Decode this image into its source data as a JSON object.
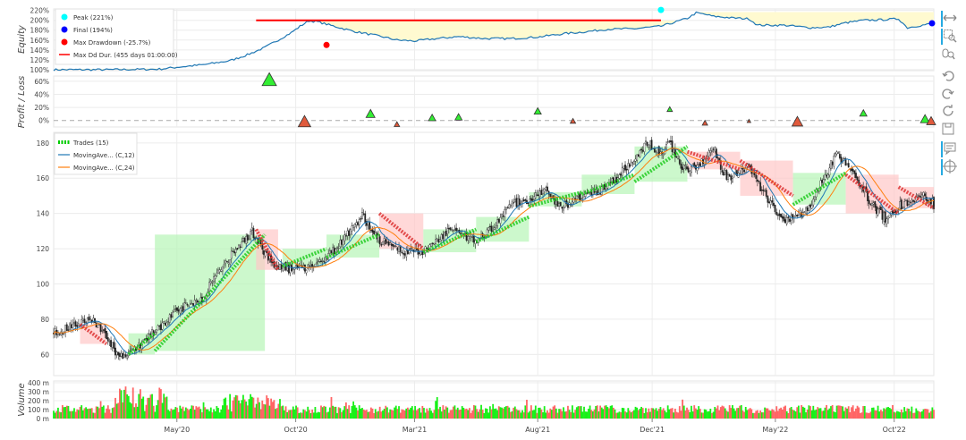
{
  "chart_data": {
    "type": "candlestick-backtest",
    "x_ticks": [
      "May'20",
      "Oct'20",
      "Mar'21",
      "Aug'21",
      "Dec'21",
      "May'22",
      "Oct'22"
    ],
    "equity": {
      "ylabel": "Equity",
      "y_ticks": [
        "220%",
        "200%",
        "180%",
        "160%",
        "140%",
        "120%",
        "100%"
      ],
      "ylim": [
        98,
        223
      ],
      "legend": {
        "peak": "Peak (221%)",
        "final": "Final (194%)",
        "max_drawdown": "Max Drawdown (-25.7%)",
        "max_dd_dur": "Max Dd Dur. (455 days 01:00:00)"
      },
      "points": [
        [
          0,
          100
        ],
        [
          0.06,
          100
        ],
        [
          0.12,
          101
        ],
        [
          0.14,
          105
        ],
        [
          0.17,
          110
        ],
        [
          0.2,
          118
        ],
        [
          0.22,
          130
        ],
        [
          0.24,
          145
        ],
        [
          0.26,
          165
        ],
        [
          0.27,
          175
        ],
        [
          0.28,
          188
        ],
        [
          0.29,
          199
        ],
        [
          0.3,
          197
        ],
        [
          0.31,
          192
        ],
        [
          0.34,
          178
        ],
        [
          0.37,
          168
        ],
        [
          0.39,
          160
        ],
        [
          0.41,
          158
        ],
        [
          0.43,
          162
        ],
        [
          0.46,
          167
        ],
        [
          0.49,
          163
        ],
        [
          0.52,
          163
        ],
        [
          0.55,
          166
        ],
        [
          0.58,
          173
        ],
        [
          0.6,
          176
        ],
        [
          0.63,
          182
        ],
        [
          0.66,
          183
        ],
        [
          0.69,
          188
        ],
        [
          0.7,
          193
        ],
        [
          0.72,
          204
        ],
        [
          0.73,
          215
        ],
        [
          0.74,
          212
        ],
        [
          0.75,
          208
        ],
        [
          0.77,
          205
        ],
        [
          0.79,
          203
        ],
        [
          0.8,
          190
        ],
        [
          0.83,
          190
        ],
        [
          0.86,
          185
        ],
        [
          0.88,
          186
        ],
        [
          0.9,
          195
        ],
        [
          0.92,
          200
        ],
        [
          0.94,
          201
        ],
        [
          0.96,
          203
        ],
        [
          0.97,
          185
        ],
        [
          0.98,
          188
        ],
        [
          1.0,
          194
        ]
      ],
      "peak_point": [
        0.69,
        221
      ],
      "final_point": [
        1.0,
        194
      ],
      "drawdown_point": [
        0.31,
        150
      ],
      "dd_duration": [
        0.23,
        0.69,
        200
      ]
    },
    "profit_loss": {
      "ylabel": "Profit / Loss",
      "y_ticks": [
        "60%",
        "40%",
        "20%",
        "0%"
      ],
      "ylim": [
        -10,
        68
      ],
      "trades": [
        {
          "x": 0.245,
          "pnl": 62,
          "size": 8,
          "win": true
        },
        {
          "x": 0.285,
          "pnl": -2,
          "size": 7,
          "win": false
        },
        {
          "x": 0.36,
          "pnl": 10,
          "size": 5,
          "win": true
        },
        {
          "x": 0.39,
          "pnl": -6,
          "size": 3,
          "win": false
        },
        {
          "x": 0.43,
          "pnl": 4,
          "size": 4,
          "win": true
        },
        {
          "x": 0.46,
          "pnl": 5,
          "size": 4,
          "win": true
        },
        {
          "x": 0.55,
          "pnl": 14,
          "size": 4,
          "win": true
        },
        {
          "x": 0.59,
          "pnl": -1,
          "size": 3,
          "win": false
        },
        {
          "x": 0.7,
          "pnl": 17,
          "size": 3,
          "win": true
        },
        {
          "x": 0.74,
          "pnl": -4,
          "size": 3,
          "win": false
        },
        {
          "x": 0.79,
          "pnl": -1,
          "size": 2,
          "win": false
        },
        {
          "x": 0.845,
          "pnl": -2,
          "size": 6,
          "win": false
        },
        {
          "x": 0.92,
          "pnl": 11,
          "size": 4,
          "win": true
        },
        {
          "x": 0.99,
          "pnl": 2,
          "size": 5,
          "win": true
        },
        {
          "x": 1.0,
          "pnl": -1,
          "size": 5,
          "win": false
        }
      ]
    },
    "ohlc": {
      "y_ticks": [
        "180",
        "160",
        "140",
        "120",
        "100",
        "80",
        "60"
      ],
      "ylim": [
        48,
        186
      ],
      "legend": {
        "trades": "Trades (15)",
        "ma1": "MovingAve... (C,12)",
        "ma2": "MovingAve... (C,24)"
      },
      "price_path": [
        [
          0,
          72
        ],
        [
          0.03,
          78
        ],
        [
          0.045,
          80
        ],
        [
          0.06,
          70
        ],
        [
          0.075,
          58
        ],
        [
          0.09,
          62
        ],
        [
          0.11,
          71
        ],
        [
          0.13,
          80
        ],
        [
          0.15,
          88
        ],
        [
          0.17,
          92
        ],
        [
          0.18,
          102
        ],
        [
          0.2,
          115
        ],
        [
          0.225,
          130
        ],
        [
          0.24,
          118
        ],
        [
          0.25,
          111
        ],
        [
          0.27,
          108
        ],
        [
          0.29,
          110
        ],
        [
          0.31,
          115
        ],
        [
          0.33,
          125
        ],
        [
          0.35,
          139
        ],
        [
          0.37,
          125
        ],
        [
          0.385,
          121
        ],
        [
          0.4,
          118
        ],
        [
          0.42,
          119
        ],
        [
          0.44,
          126
        ],
        [
          0.455,
          133
        ],
        [
          0.47,
          126
        ],
        [
          0.48,
          124
        ],
        [
          0.5,
          132
        ],
        [
          0.52,
          145
        ],
        [
          0.54,
          148
        ],
        [
          0.56,
          153
        ],
        [
          0.575,
          143
        ],
        [
          0.6,
          150
        ],
        [
          0.62,
          153
        ],
        [
          0.64,
          160
        ],
        [
          0.66,
          172
        ],
        [
          0.675,
          180
        ],
        [
          0.69,
          174
        ],
        [
          0.7,
          180
        ],
        [
          0.715,
          165
        ],
        [
          0.73,
          166
        ],
        [
          0.75,
          178
        ],
        [
          0.76,
          163
        ],
        [
          0.77,
          160
        ],
        [
          0.79,
          167
        ],
        [
          0.8,
          157
        ],
        [
          0.815,
          145
        ],
        [
          0.83,
          135
        ],
        [
          0.845,
          138
        ],
        [
          0.86,
          145
        ],
        [
          0.875,
          160
        ],
        [
          0.89,
          174
        ],
        [
          0.9,
          168
        ],
        [
          0.915,
          158
        ],
        [
          0.93,
          145
        ],
        [
          0.945,
          137
        ],
        [
          0.96,
          144
        ],
        [
          0.975,
          148
        ],
        [
          0.99,
          150
        ],
        [
          1.0,
          145
        ]
      ],
      "trade_zones": [
        {
          "x0": 0.03,
          "x1": 0.06,
          "entry": 77,
          "exit": 66,
          "win": false
        },
        {
          "x0": 0.085,
          "x1": 0.115,
          "entry": 60,
          "exit": 72,
          "win": true
        },
        {
          "x0": 0.115,
          "x1": 0.24,
          "entry": 62,
          "exit": 128,
          "win": true
        },
        {
          "x0": 0.23,
          "x1": 0.255,
          "entry": 131,
          "exit": 108,
          "win": false
        },
        {
          "x0": 0.26,
          "x1": 0.31,
          "entry": 110,
          "exit": 120,
          "win": true
        },
        {
          "x0": 0.31,
          "x1": 0.37,
          "entry": 115,
          "exit": 128,
          "win": true
        },
        {
          "x0": 0.37,
          "x1": 0.42,
          "entry": 140,
          "exit": 120,
          "win": false
        },
        {
          "x0": 0.42,
          "x1": 0.48,
          "entry": 118,
          "exit": 131,
          "win": true
        },
        {
          "x0": 0.48,
          "x1": 0.54,
          "entry": 124,
          "exit": 138,
          "win": true
        },
        {
          "x0": 0.54,
          "x1": 0.6,
          "entry": 144,
          "exit": 152,
          "win": true
        },
        {
          "x0": 0.6,
          "x1": 0.66,
          "entry": 151,
          "exit": 162,
          "win": true
        },
        {
          "x0": 0.66,
          "x1": 0.72,
          "entry": 158,
          "exit": 178,
          "win": true
        },
        {
          "x0": 0.72,
          "x1": 0.78,
          "entry": 175,
          "exit": 165,
          "win": false
        },
        {
          "x0": 0.78,
          "x1": 0.84,
          "entry": 170,
          "exit": 150,
          "win": false
        },
        {
          "x0": 0.84,
          "x1": 0.9,
          "entry": 145,
          "exit": 163,
          "win": true
        },
        {
          "x0": 0.9,
          "x1": 0.96,
          "entry": 162,
          "exit": 140,
          "win": false
        },
        {
          "x0": 0.96,
          "x1": 1.0,
          "entry": 155,
          "exit": 143,
          "win": false
        }
      ]
    },
    "volume": {
      "ylabel": "Volume",
      "y_ticks": [
        "400 m",
        "300 m",
        "200 m",
        "100 m",
        "0 m"
      ],
      "ylim": [
        0,
        420
      ]
    }
  },
  "colors": {
    "equity": "#1f77b4",
    "ma1": "#1f77b4",
    "ma2": "#ff7f0e",
    "up": "#00ee00",
    "down": "#ff5555",
    "peak": "#00ffff",
    "final": "#0000ff",
    "drawdown": "#ff0000",
    "win_zone": "#b7f5b7",
    "loss_zone": "#ffc8c8",
    "dd_fill": "#fffad0"
  },
  "toolbar": [
    "pan-icon",
    "box-zoom-icon",
    "wheel-zoom-icon",
    "undo-icon",
    "redo-icon",
    "reset-icon",
    "save-icon",
    "hover-icon",
    "crosshair-icon"
  ]
}
